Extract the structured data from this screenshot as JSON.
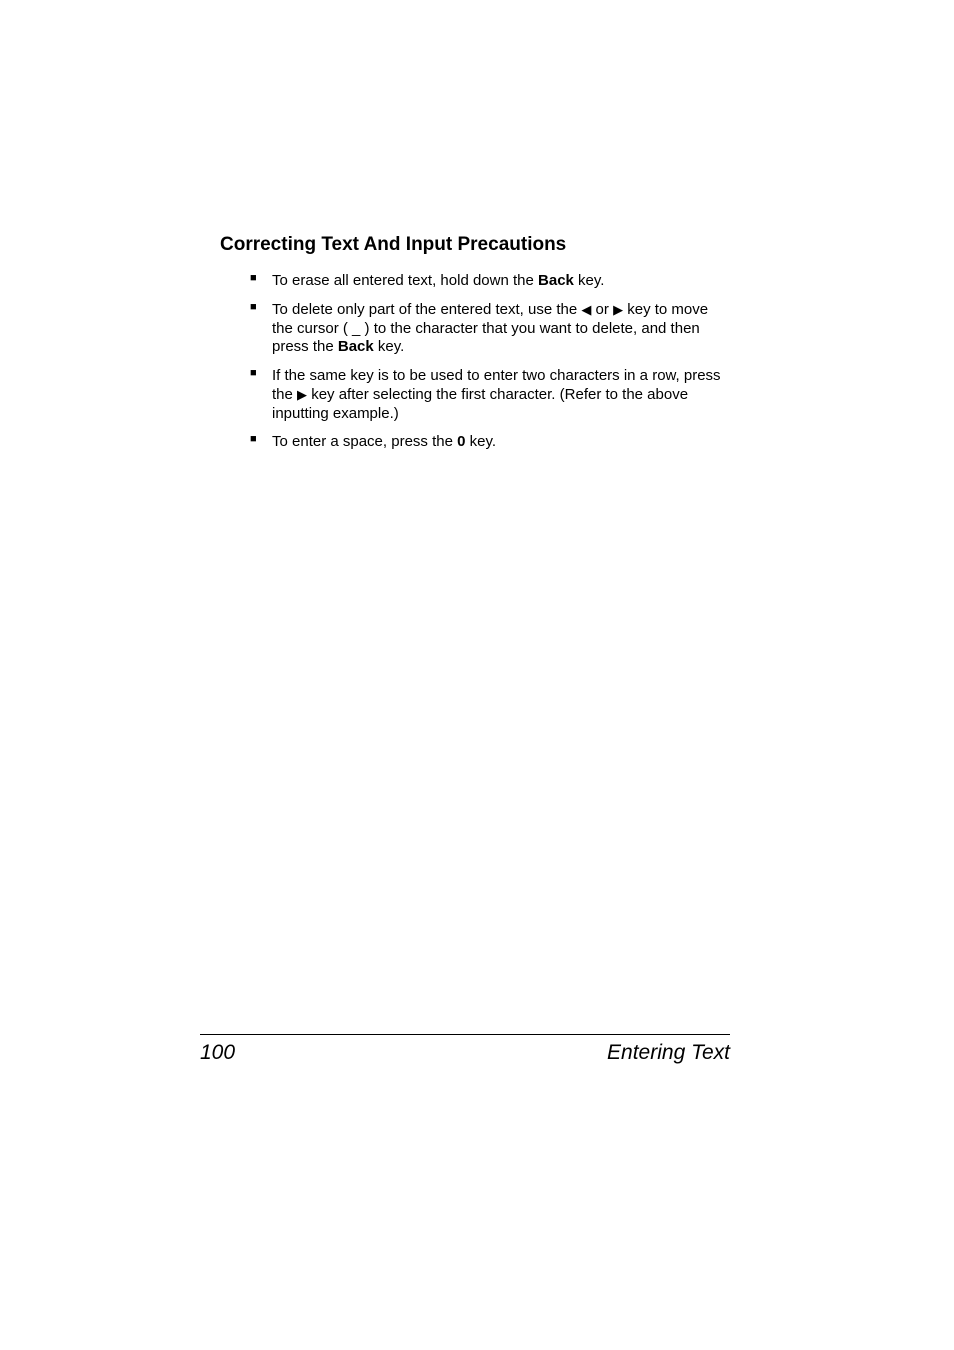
{
  "heading": "Correcting Text And Input Precautions",
  "bullets": [
    {
      "pre": "To erase all entered text, hold down the ",
      "bold1": "Back",
      "post": " key."
    },
    {
      "pre": "To delete only part of the entered text, use the ",
      "arrow1": "◀",
      "mid1": " or ",
      "arrow2": "▶",
      "mid2": " key to move the cursor ( _ ) to the character that you want to delete, and then press the ",
      "bold1": "Back",
      "post": " key."
    },
    {
      "pre": "If the same key is to be used to enter two characters in a row, press the ",
      "arrow1": "▶",
      "post": " key after selecting the first character. (Refer to the above inputting example.)"
    },
    {
      "pre": "To enter a space, press the ",
      "bold1": "0",
      "post": " key."
    }
  ],
  "footer": {
    "page_number": "100",
    "section": "Entering Text"
  }
}
